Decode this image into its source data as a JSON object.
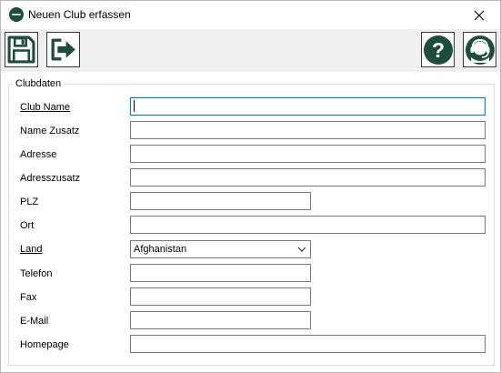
{
  "window": {
    "title": "Neuen Club erfassen"
  },
  "icons": {
    "app": "app-logo-icon",
    "close": "close-icon",
    "save": "save-icon",
    "exit": "exit-icon",
    "help": "help-icon",
    "support": "support-headset-icon",
    "dropdown": "chevron-down-icon"
  },
  "colors": {
    "accent": "#1f4d3c",
    "focus_border": "#0078d7",
    "toolbar_bg": "#f0f0f0"
  },
  "group": {
    "title": "Clubdaten"
  },
  "fields": {
    "club_name": {
      "label": "Club Name",
      "value": ""
    },
    "name_zusatz": {
      "label": "Name Zusatz",
      "value": ""
    },
    "adresse": {
      "label": "Adresse",
      "value": ""
    },
    "adresszusatz": {
      "label": "Adresszusatz",
      "value": ""
    },
    "plz": {
      "label": "PLZ",
      "value": ""
    },
    "ort": {
      "label": "Ort",
      "value": ""
    },
    "land": {
      "label": "Land",
      "value": "Afghanistan"
    },
    "telefon": {
      "label": "Telefon",
      "value": ""
    },
    "fax": {
      "label": "Fax",
      "value": ""
    },
    "email": {
      "label": "E-Mail",
      "value": ""
    },
    "homepage": {
      "label": "Homepage",
      "value": ""
    }
  }
}
